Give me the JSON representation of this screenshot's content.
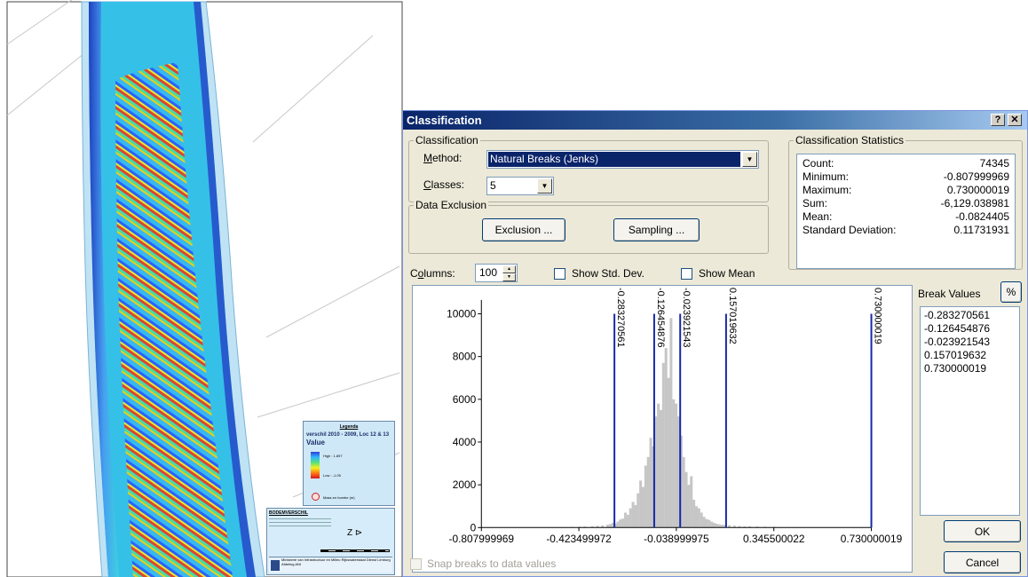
{
  "map_legend": {
    "heading": "Legenda",
    "layer": "verschil 2010 - 2009, Loc 12 & 13",
    "field": "Value",
    "high": "High : 1.897",
    "low": "Low : -1.05",
    "mask": "Mass en bombe (m)"
  },
  "map_titleblock": {
    "heading": "BODEMVERSCHIL",
    "footer": "Ministerie van Infrastructuur en Milieu Rijkswaterstaat Dienst Limburg Afdeling ANI"
  },
  "dialog": {
    "title": "Classification",
    "help_btn": "?",
    "close_btn": "✕",
    "classification_group": "Classification",
    "method_label": "Method:",
    "method_value": "Natural Breaks (Jenks)",
    "classes_label": "Classes:",
    "classes_value": "5",
    "exclusion_group": "Data Exclusion",
    "exclusion_btn": "Exclusion ...",
    "sampling_btn": "Sampling ...",
    "stats_group": "Classification Statistics",
    "stats": [
      {
        "label": "Count:",
        "value": "74345"
      },
      {
        "label": "Minimum:",
        "value": "-0.807999969"
      },
      {
        "label": "Maximum:",
        "value": "0.730000019"
      },
      {
        "label": "Sum:",
        "value": "-6,129.038981"
      },
      {
        "label": "Mean:",
        "value": "-0.0824405"
      },
      {
        "label": "Standard Deviation:",
        "value": "0.11731931"
      }
    ],
    "columns_label": "Columns:",
    "columns_value": "100",
    "show_std_dev": "Show Std. Dev.",
    "show_mean": "Show Mean",
    "break_values_label": "Break Values",
    "percent_btn": "%",
    "break_values": [
      "-0.283270561",
      "-0.126454876",
      "-0.023921543",
      "0.157019632",
      "0.730000019"
    ],
    "ok_btn": "OK",
    "cancel_btn": "Cancel",
    "snap_label": "Snap breaks to data values"
  },
  "chart_data": {
    "type": "bar",
    "xlim": [
      -0.807999969,
      0.730000019
    ],
    "ylim": [
      0,
      10400
    ],
    "y_ticks": [
      0,
      2000,
      4000,
      6000,
      8000,
      10000
    ],
    "x_tick_labels": [
      "-0.807999969",
      "-0.423499972",
      "-0.038999975",
      "0.345500022",
      "0.730000019"
    ],
    "x_tick_values": [
      -0.807999969,
      -0.423499972,
      -0.038999975,
      0.345500022,
      0.730000019
    ],
    "breaks": [
      -0.283270561,
      -0.126454876,
      -0.023921543,
      0.157019632,
      0.730000019
    ],
    "break_labels": [
      "-0.283270561",
      "-0.126454876",
      "-0.023921543",
      "0.157019632",
      "0.730000019"
    ],
    "bins": [
      [
        -0.5,
        20
      ],
      [
        -0.45,
        30
      ],
      [
        -0.42,
        40
      ],
      [
        -0.4,
        50
      ],
      [
        -0.37,
        60
      ],
      [
        -0.35,
        80
      ],
      [
        -0.33,
        100
      ],
      [
        -0.31,
        130
      ],
      [
        -0.3,
        160
      ],
      [
        -0.29,
        220
      ],
      [
        -0.28,
        180
      ],
      [
        -0.27,
        280
      ],
      [
        -0.26,
        380
      ],
      [
        -0.25,
        420
      ],
      [
        -0.24,
        700
      ],
      [
        -0.23,
        600
      ],
      [
        -0.22,
        900
      ],
      [
        -0.21,
        1200
      ],
      [
        -0.2,
        1050
      ],
      [
        -0.19,
        1600
      ],
      [
        -0.18,
        2200
      ],
      [
        -0.17,
        1900
      ],
      [
        -0.16,
        2900
      ],
      [
        -0.15,
        3300
      ],
      [
        -0.14,
        4200
      ],
      [
        -0.13,
        3800
      ],
      [
        -0.12,
        5200
      ],
      [
        -0.11,
        5800
      ],
      [
        -0.1,
        5500
      ],
      [
        -0.09,
        7700
      ],
      [
        -0.08,
        8400
      ],
      [
        -0.07,
        7000
      ],
      [
        -0.06,
        9800
      ],
      [
        -0.05,
        6000
      ],
      [
        -0.04,
        5800
      ],
      [
        -0.03,
        5200
      ],
      [
        -0.02,
        4300
      ],
      [
        -0.01,
        3300
      ],
      [
        0.0,
        2600
      ],
      [
        0.01,
        2000
      ],
      [
        0.02,
        2400
      ],
      [
        0.03,
        1300
      ],
      [
        0.04,
        1000
      ],
      [
        0.05,
        900
      ],
      [
        0.06,
        700
      ],
      [
        0.07,
        500
      ],
      [
        0.08,
        400
      ],
      [
        0.09,
        360
      ],
      [
        0.1,
        280
      ],
      [
        0.11,
        220
      ],
      [
        0.12,
        180
      ],
      [
        0.13,
        150
      ],
      [
        0.14,
        130
      ],
      [
        0.15,
        120
      ],
      [
        0.17,
        110
      ],
      [
        0.19,
        90
      ],
      [
        0.21,
        70
      ],
      [
        0.23,
        60
      ],
      [
        0.25,
        60
      ],
      [
        0.28,
        50
      ],
      [
        0.31,
        40
      ],
      [
        0.35,
        30
      ],
      [
        0.4,
        20
      ]
    ]
  },
  "colors": {
    "break_line": "#1428a8",
    "bar": "#c6c6c6",
    "dialog_bg": "#ece9d8",
    "title_bar": "#0a246a"
  }
}
